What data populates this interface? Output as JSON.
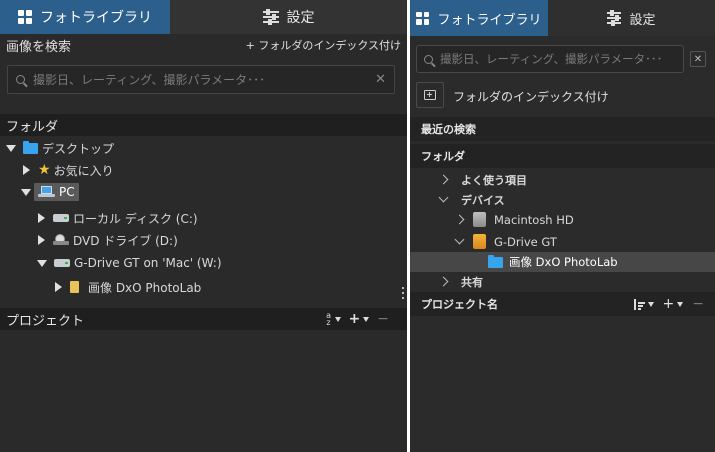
{
  "left": {
    "tabs": [
      {
        "label": "フォトライブラリ",
        "icon": "grid-icon",
        "active": true
      },
      {
        "label": "設定",
        "icon": "sliders-icon",
        "active": false
      }
    ],
    "search_section": {
      "title": "画像を検索",
      "index_link": "+ フォルダのインデックス付け",
      "placeholder": "撮影日、レーティング、撮影パラメータ･･･"
    },
    "folders_header": "フォルダ",
    "tree": {
      "desktop": "デスクトップ",
      "favorites": "お気に入り",
      "pc": "PC",
      "local_disk": "ローカル ディスク (C:)",
      "dvd": "DVD ドライブ (D:)",
      "gdrive": "G-Drive GT on 'Mac' (W:)",
      "photolab": "画像 DxO PhotoLab"
    },
    "projects_header": "プロジェクト",
    "projects_controls": {
      "sort": "a z",
      "add": "+",
      "remove": "−"
    }
  },
  "right": {
    "tabs": [
      {
        "label": "フォトライブラリ",
        "icon": "grid-icon",
        "active": true
      },
      {
        "label": "設定",
        "icon": "sliders-icon",
        "active": false
      }
    ],
    "search_placeholder": "撮影日、レーティング、撮影パラメータ･･･",
    "index_button": "フォルダのインデックス付け",
    "recent_search": "最近の検索",
    "folders_header": "フォルダ",
    "tree": {
      "favorites": "よく使う項目",
      "devices": "デバイス",
      "macintosh_hd": "Macintosh HD",
      "gdrive": "G-Drive GT",
      "photolab": "画像 DxO PhotoLab",
      "shared": "共有"
    },
    "projects_header": "プロジェクト名",
    "projects_controls": {
      "add": "+",
      "remove": "−"
    }
  },
  "colors": {
    "accent": "#2d5f8d",
    "selection": "#474747",
    "background": "#2a2a2a",
    "header": "#1f1f1f"
  }
}
